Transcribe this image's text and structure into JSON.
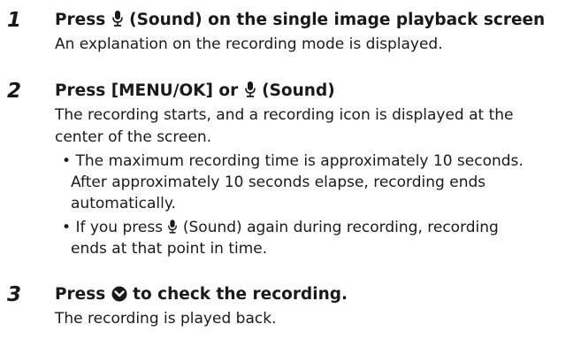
{
  "steps": [
    {
      "number": "1",
      "title_before_icon": "Press ",
      "title_icon": "microphone-icon",
      "title_after_icon": " (Sound) on the single image playback screen",
      "description": "An explanation on the recording mode is displayed."
    },
    {
      "number": "2",
      "title_before_icon": "Press [MENU/OK] or ",
      "title_icon": "microphone-icon",
      "title_after_icon": " (Sound)",
      "description_lines": [
        "The recording starts, and a recording icon is displayed at the",
        "center of the screen."
      ],
      "bullets": [
        {
          "line1": "The maximum recording time is approximately 10 seconds.",
          "continuation": [
            "After approximately 10 seconds elapse, recording ends",
            "automatically."
          ]
        },
        {
          "line1_before_icon": "If you press ",
          "line1_icon": "microphone-icon",
          "line1_after_icon": " (Sound) again during recording, recording",
          "continuation": [
            "ends at that point in time."
          ]
        }
      ]
    },
    {
      "number": "3",
      "title_before_icon": "Press ",
      "title_icon": "down-arrow-circle-icon",
      "title_after_icon": " to check the recording.",
      "description": "The recording is played back."
    }
  ],
  "bullet_char": "•",
  "colors": {
    "text": "#1a1a1a"
  }
}
